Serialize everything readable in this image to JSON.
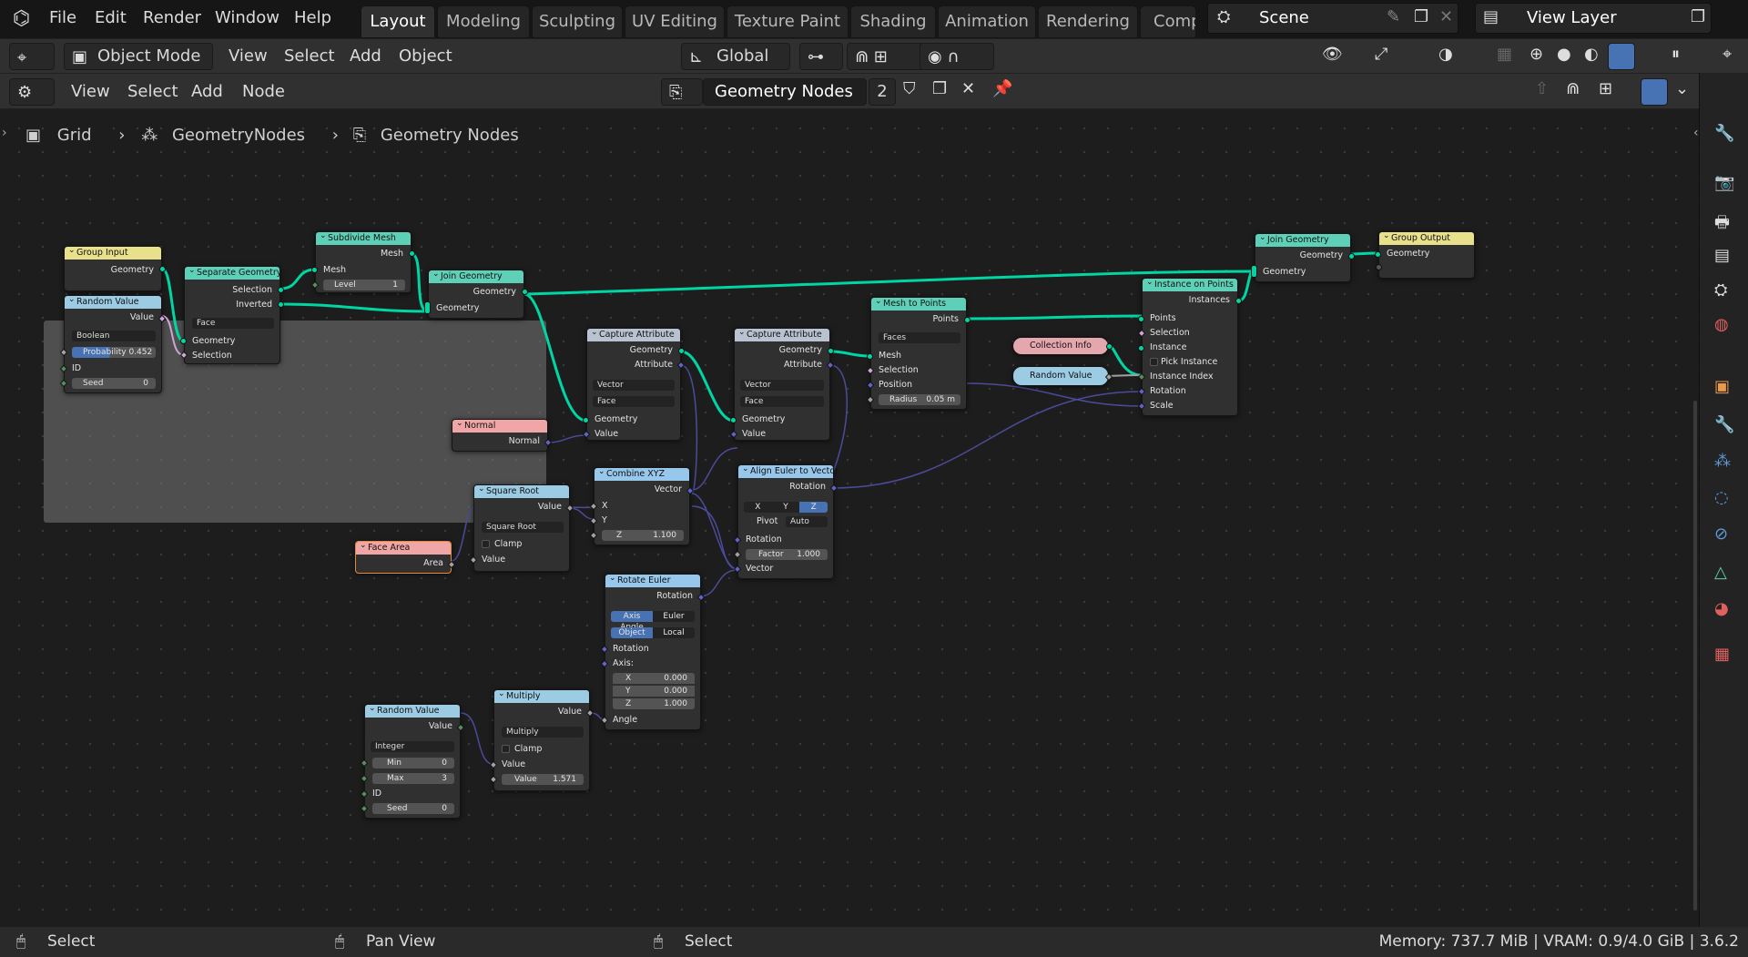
{
  "menu": [
    "File",
    "Edit",
    "Render",
    "Window",
    "Help"
  ],
  "workspaces": [
    "Layout",
    "Modeling",
    "Sculpting",
    "UV Editing",
    "Texture Paint",
    "Shading",
    "Animation",
    "Rendering",
    "Comp"
  ],
  "scene": "Scene",
  "view_layer": "View Layer",
  "header1": {
    "mode": "Object Mode",
    "menus": [
      "View",
      "Select",
      "Add",
      "Object"
    ],
    "transform": "Global"
  },
  "header2": {
    "menus": [
      "View",
      "Select",
      "Add",
      "Node"
    ],
    "node_group": "Geometry Nodes",
    "users": "2"
  },
  "breadcrumb": [
    "Grid",
    "GeometryNodes",
    "Geometry Nodes"
  ],
  "nodes": {
    "group_input": {
      "title": "Group Input",
      "out": "Geometry"
    },
    "random_value1": {
      "title": "Random Value",
      "out": "Value",
      "type": "Boolean",
      "prob_label": "Probability",
      "prob": "0.452",
      "id": "ID",
      "seed_label": "Seed",
      "seed": "0"
    },
    "separate": {
      "title": "Separate Geometry",
      "sel": "Selection",
      "inv": "Inverted",
      "domain": "Face",
      "geo": "Geometry",
      "sel2": "Selection"
    },
    "subdivide": {
      "title": "Subdivide Mesh",
      "out": "Mesh",
      "in": "Mesh",
      "level_label": "Level",
      "level": "1"
    },
    "join1": {
      "title": "Join Geometry",
      "out": "Geometry",
      "in": "Geometry"
    },
    "normal": {
      "title": "Normal",
      "out": "Normal"
    },
    "capture1": {
      "title": "Capture Attribute",
      "geo_out": "Geometry",
      "attr_out": "Attribute",
      "type": "Vector",
      "domain": "Face",
      "geo_in": "Geometry",
      "val_in": "Value"
    },
    "capture2": {
      "title": "Capture Attribute",
      "geo_out": "Geometry",
      "attr_out": "Attribute",
      "type": "Vector",
      "domain": "Face",
      "geo_in": "Geometry",
      "val_in": "Value"
    },
    "mesh_to_points": {
      "title": "Mesh to Points",
      "out": "Points",
      "mode": "Faces",
      "mesh": "Mesh",
      "sel": "Selection",
      "pos": "Position",
      "radius_label": "Radius",
      "radius": "0.05 m"
    },
    "collection_info": {
      "title": "Collection Info"
    },
    "random_value2": {
      "title": "Random Value"
    },
    "instance_on_points": {
      "title": "Instance on Points",
      "out": "Instances",
      "points": "Points",
      "sel": "Selection",
      "inst": "Instance",
      "pick": "Pick Instance",
      "index": "Instance Index",
      "rot": "Rotation",
      "scale": "Scale"
    },
    "join2": {
      "title": "Join Geometry",
      "out": "Geometry",
      "in": "Geometry"
    },
    "group_output": {
      "title": "Group Output",
      "in": "Geometry"
    },
    "combine_xyz": {
      "title": "Combine XYZ",
      "out": "Vector",
      "x": "X",
      "y": "Y",
      "z_label": "Z",
      "z": "1.100"
    },
    "square_root": {
      "title": "Square Root",
      "out": "Value",
      "op": "Square Root",
      "clamp": "Clamp",
      "in": "Value"
    },
    "face_area": {
      "title": "Face Area",
      "out": "Area"
    },
    "align_euler": {
      "title": "Align Euler to Vector",
      "out": "Rotation",
      "x": "X",
      "y": "Y",
      "z": "Z",
      "pivot_label": "Pivot",
      "pivot": "Auto",
      "rot": "Rotation",
      "factor_label": "Factor",
      "factor": "1.000",
      "vec": "Vector"
    },
    "rotate_euler": {
      "title": "Rotate Euler",
      "out": "Rotation",
      "t1": "Axis Angle",
      "t2": "Euler",
      "s1": "Object",
      "s2": "Local",
      "rot": "Rotation",
      "axis": "Axis:",
      "x_label": "X",
      "x": "0.000",
      "y_label": "Y",
      "y": "0.000",
      "z_label": "Z",
      "z": "1.000",
      "angle": "Angle"
    },
    "random_value3": {
      "title": "Random Value",
      "out": "Value",
      "type": "Integer",
      "min_label": "Min",
      "min": "0",
      "max_label": "Max",
      "max": "3",
      "id": "ID",
      "seed_label": "Seed",
      "seed": "0"
    },
    "multiply": {
      "title": "Multiply",
      "out": "Value",
      "op": "Multiply",
      "clamp": "Clamp",
      "in": "Value",
      "val_label": "Value",
      "val": "1.571"
    }
  },
  "status": {
    "left": "Select",
    "mid": "Pan View",
    "right": "Select",
    "info": "Memory: 737.7 MiB | VRAM: 0.9/4.0 GiB | 3.6.2"
  }
}
